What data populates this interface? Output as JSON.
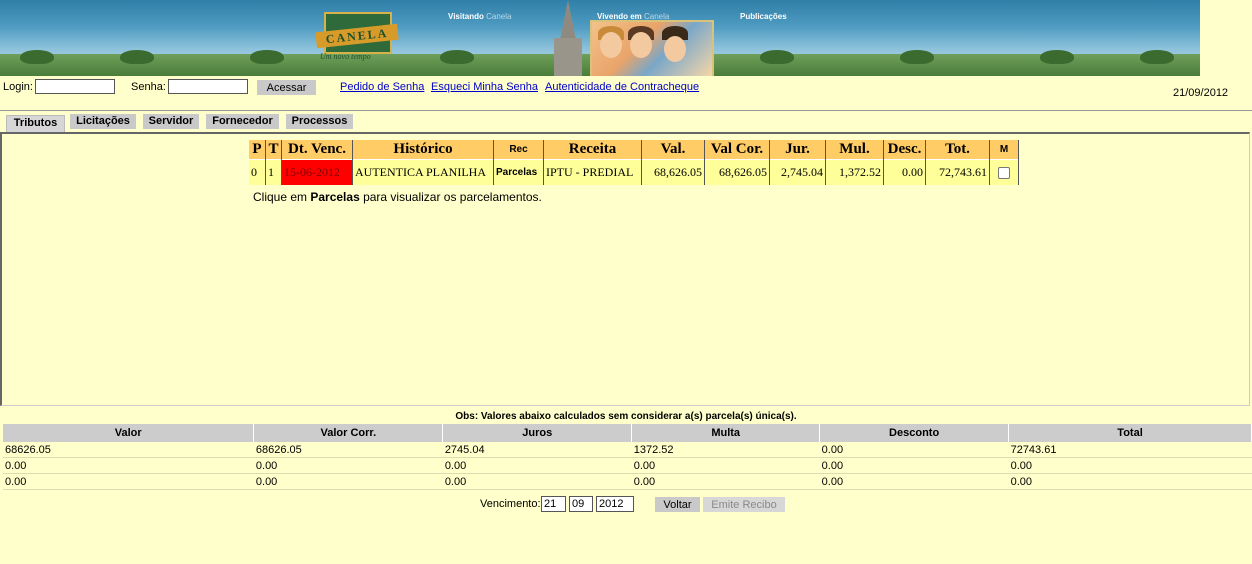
{
  "banner": {
    "logo_text": "CANELA",
    "logo_tagline": "Um novo tempo",
    "nav": [
      {
        "bold": "Visitando",
        "faded": "Canela"
      },
      {
        "bold": "Vivendo em",
        "faded": "Canela"
      },
      {
        "bold": "Publicações",
        "faded": ""
      }
    ]
  },
  "login": {
    "login_label": "Login:",
    "login_value": "",
    "senha_label": "Senha:",
    "senha_value": "",
    "submit_label": "Acessar"
  },
  "links": {
    "pedido_senha": "Pedido de Senha",
    "esqueci_senha": "Esqueci Minha Senha",
    "autenticidade": "Autenticidade de Contracheque"
  },
  "date": "21/09/2012",
  "tabs": [
    "Tributos",
    "Licitações",
    "Servidor",
    "Fornecedor",
    "Processos"
  ],
  "active_tab": "Tributos",
  "tributos_table": {
    "headers": {
      "p": "P",
      "t": "T",
      "dt_venc": "Dt. Venc.",
      "historico": "Histórico",
      "rec": "Rec",
      "receita": "Receita",
      "val": "Val.",
      "val_cor": "Val Cor.",
      "jur": "Jur.",
      "mul": "Mul.",
      "desc": "Desc.",
      "tot": "Tot.",
      "m": "M"
    },
    "row": {
      "p": "0",
      "t": "1",
      "dt_venc": "15-06-2012",
      "historico": "AUTENTICA PLANILHA",
      "rec": "Parcelas",
      "receita": "IPTU - PREDIAL",
      "val": "68,626.05",
      "val_cor": "68,626.05",
      "jur": "2,745.04",
      "mul": "1,372.52",
      "desc": "0.00",
      "tot": "72,743.61",
      "m_checked": false
    }
  },
  "hint": {
    "before": "Clique em ",
    "bold": "Parcelas",
    "after": " para visualizar os parcelamentos."
  },
  "summary": {
    "obs": "Obs: Valores abaixo calculados sem considerar a(s) parcela(s) única(s).",
    "headers": [
      "Valor",
      "Valor Corr.",
      "Juros",
      "Multa",
      "Desconto",
      "Total"
    ],
    "rows": [
      [
        "68626.05",
        "68626.05",
        "2745.04",
        "1372.52",
        "0.00",
        "72743.61"
      ],
      [
        "0.00",
        "0.00",
        "0.00",
        "0.00",
        "0.00",
        "0.00"
      ],
      [
        "0.00",
        "0.00",
        "0.00",
        "0.00",
        "0.00",
        "0.00"
      ]
    ]
  },
  "vencimento": {
    "label": "Vencimento:",
    "day": "21",
    "month": "09",
    "year": "2012",
    "voltar": "Voltar",
    "emite_recibo": "Emite Recibo"
  }
}
